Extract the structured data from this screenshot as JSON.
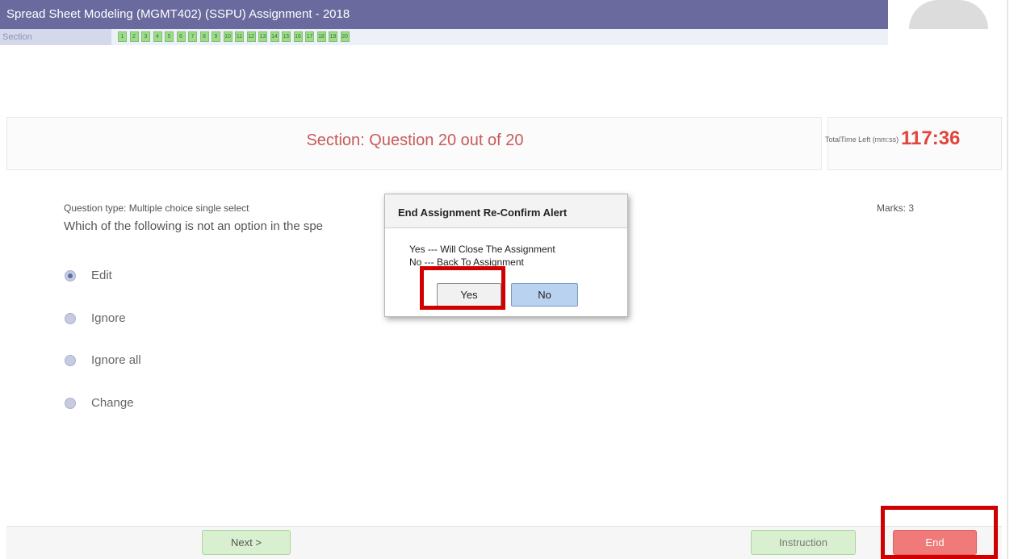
{
  "header": {
    "title": "Spread Sheet Modeling (MGMT402) (SSPU) Assignment - 2018"
  },
  "section_nav": {
    "label": "Section",
    "questions": [
      "1",
      "2",
      "3",
      "4",
      "5",
      "6",
      "7",
      "8",
      "9",
      "10",
      "11",
      "12",
      "13",
      "14",
      "15",
      "16",
      "17",
      "18",
      "19",
      "20"
    ]
  },
  "status": {
    "question_counter": "Section: Question 20 out of 20",
    "timer_label": "TotalTime Left (mm:ss)",
    "timer_value": "117:36"
  },
  "question": {
    "type": "Question type:  Multiple choice single select",
    "marks": "Marks:  3",
    "text": "Which of the following is not an option in the spe",
    "options": [
      {
        "label": "Edit",
        "selected": true
      },
      {
        "label": "Ignore",
        "selected": false
      },
      {
        "label": "Ignore all",
        "selected": false
      },
      {
        "label": "Change",
        "selected": false
      }
    ]
  },
  "footer": {
    "next_label": "Next >",
    "instruction_label": "Instruction",
    "end_label": "End"
  },
  "dialog": {
    "title": "End Assignment Re-Confirm Alert",
    "line1": "Yes  ---  Will Close The Assignment",
    "line2": "No  ---  Back To Assignment",
    "yes_label": "Yes",
    "no_label": "No"
  },
  "colors": {
    "title_bar": "#6a6a9e",
    "timer": "#e0453c",
    "question_counter": "#c85a5a",
    "highlight": "#d00000",
    "question_box": "#9fdb8d",
    "end_button": "#f07a7a"
  }
}
